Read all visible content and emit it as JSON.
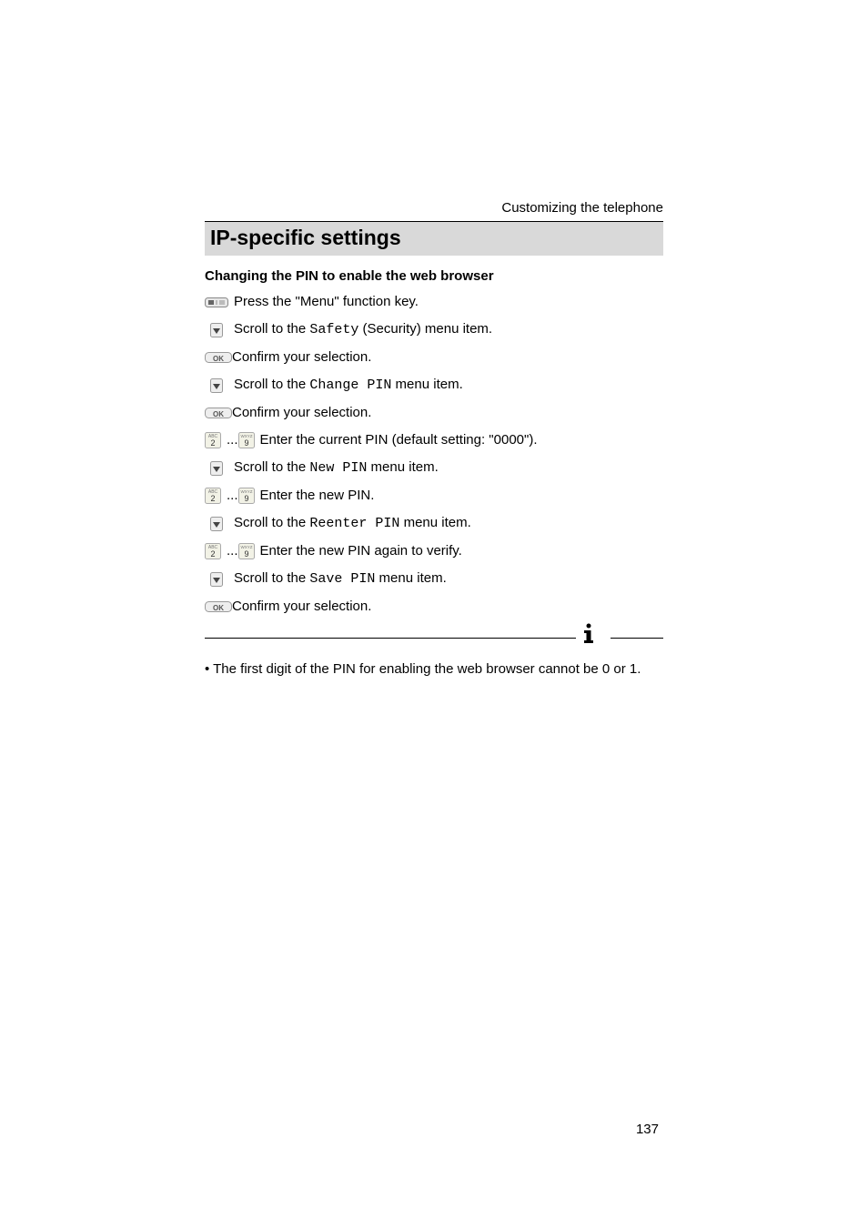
{
  "header": {
    "running_head": "Customizing the telephone"
  },
  "section": {
    "title": "IP-specific settings",
    "subheading": "Changing the PIN to enable the web browser"
  },
  "steps": {
    "s1_text": " Press the \"Menu\" function key.",
    "s2_pre": " Scroll to the ",
    "s2_code": "Safety",
    "s2_post": " (Security) menu item.",
    "s3_text": " Confirm your selection.",
    "s4_pre": " Scroll to the ",
    "s4_code": "Change PIN",
    "s4_post": " menu item.",
    "s5_text": " Confirm your selection.",
    "s6_sep": " ... ",
    "s6_text": " Enter the current PIN (default setting: \"0000\").",
    "s7_pre": " Scroll to the ",
    "s7_code": "New PIN",
    "s7_post": " menu item.",
    "s8_sep": "... ",
    "s8_text": " Enter the new PIN.",
    "s9_pre": " Scroll to the ",
    "s9_code": "Reenter PIN",
    "s9_post": " menu item.",
    "s10_sep": "... ",
    "s10_text": " Enter the new PIN again to verify.",
    "s11_pre": " Scroll to the ",
    "s11_code": "Save PIN",
    "s11_post": " menu item.",
    "s12_text": " Confirm your selection."
  },
  "note": {
    "text": "•  The first digit of the PIN for enabling the web browser cannot be 0 or 1."
  },
  "footer": {
    "page_number": "137"
  },
  "icons": {
    "menu_key": "menu-key-icon",
    "scroll_down": "scroll-down-icon",
    "ok_key": "ok-key-icon",
    "key_2": "digit-2-key-icon",
    "key_9": "digit-9-key-icon",
    "info": "info-icon"
  }
}
